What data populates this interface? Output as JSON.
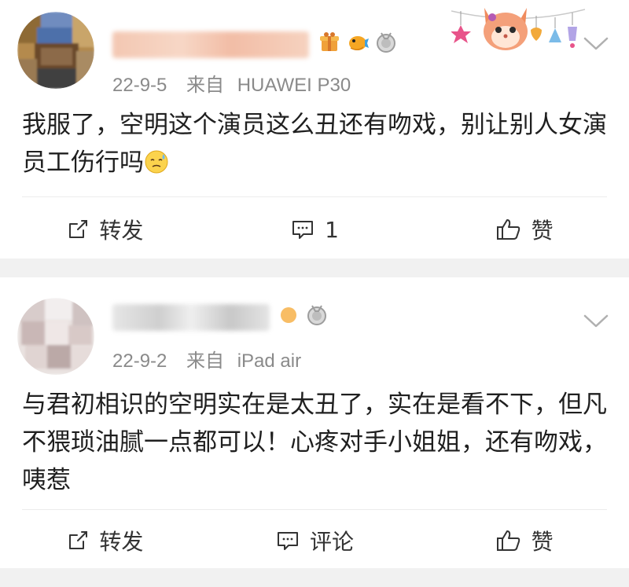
{
  "posts": [
    {
      "date": "22-9-5",
      "source_prefix": "来自",
      "source_device": "HUAWEI P30",
      "text": "我服了，空明这个演员这么丑还有吻戏，别让别人女演员工伤行吗",
      "emoji": "sweat-face",
      "actions": {
        "repost_label": "转发",
        "comment_label": "1",
        "like_label": "赞"
      },
      "badges": [
        "gift-box-badge",
        "pufferfish-badge",
        "silver-medal-badge"
      ]
    },
    {
      "date": "22-9-2",
      "source_prefix": "来自",
      "source_device": "iPad air",
      "text": "与君初相识的空明实在是太丑了，实在是看不下，但凡不猥琐油腻一点都可以！心疼对手小姐姐，还有吻戏，咦惹",
      "actions": {
        "repost_label": "转发",
        "comment_label": "评论",
        "like_label": "赞"
      },
      "badges": [
        "orange-badge",
        "silver-medal-badge"
      ]
    }
  ],
  "colors": {
    "background": "#f1f1f1",
    "card": "#ffffff",
    "meta_gray": "#8a8a8a",
    "text": "#1f1f1f"
  }
}
